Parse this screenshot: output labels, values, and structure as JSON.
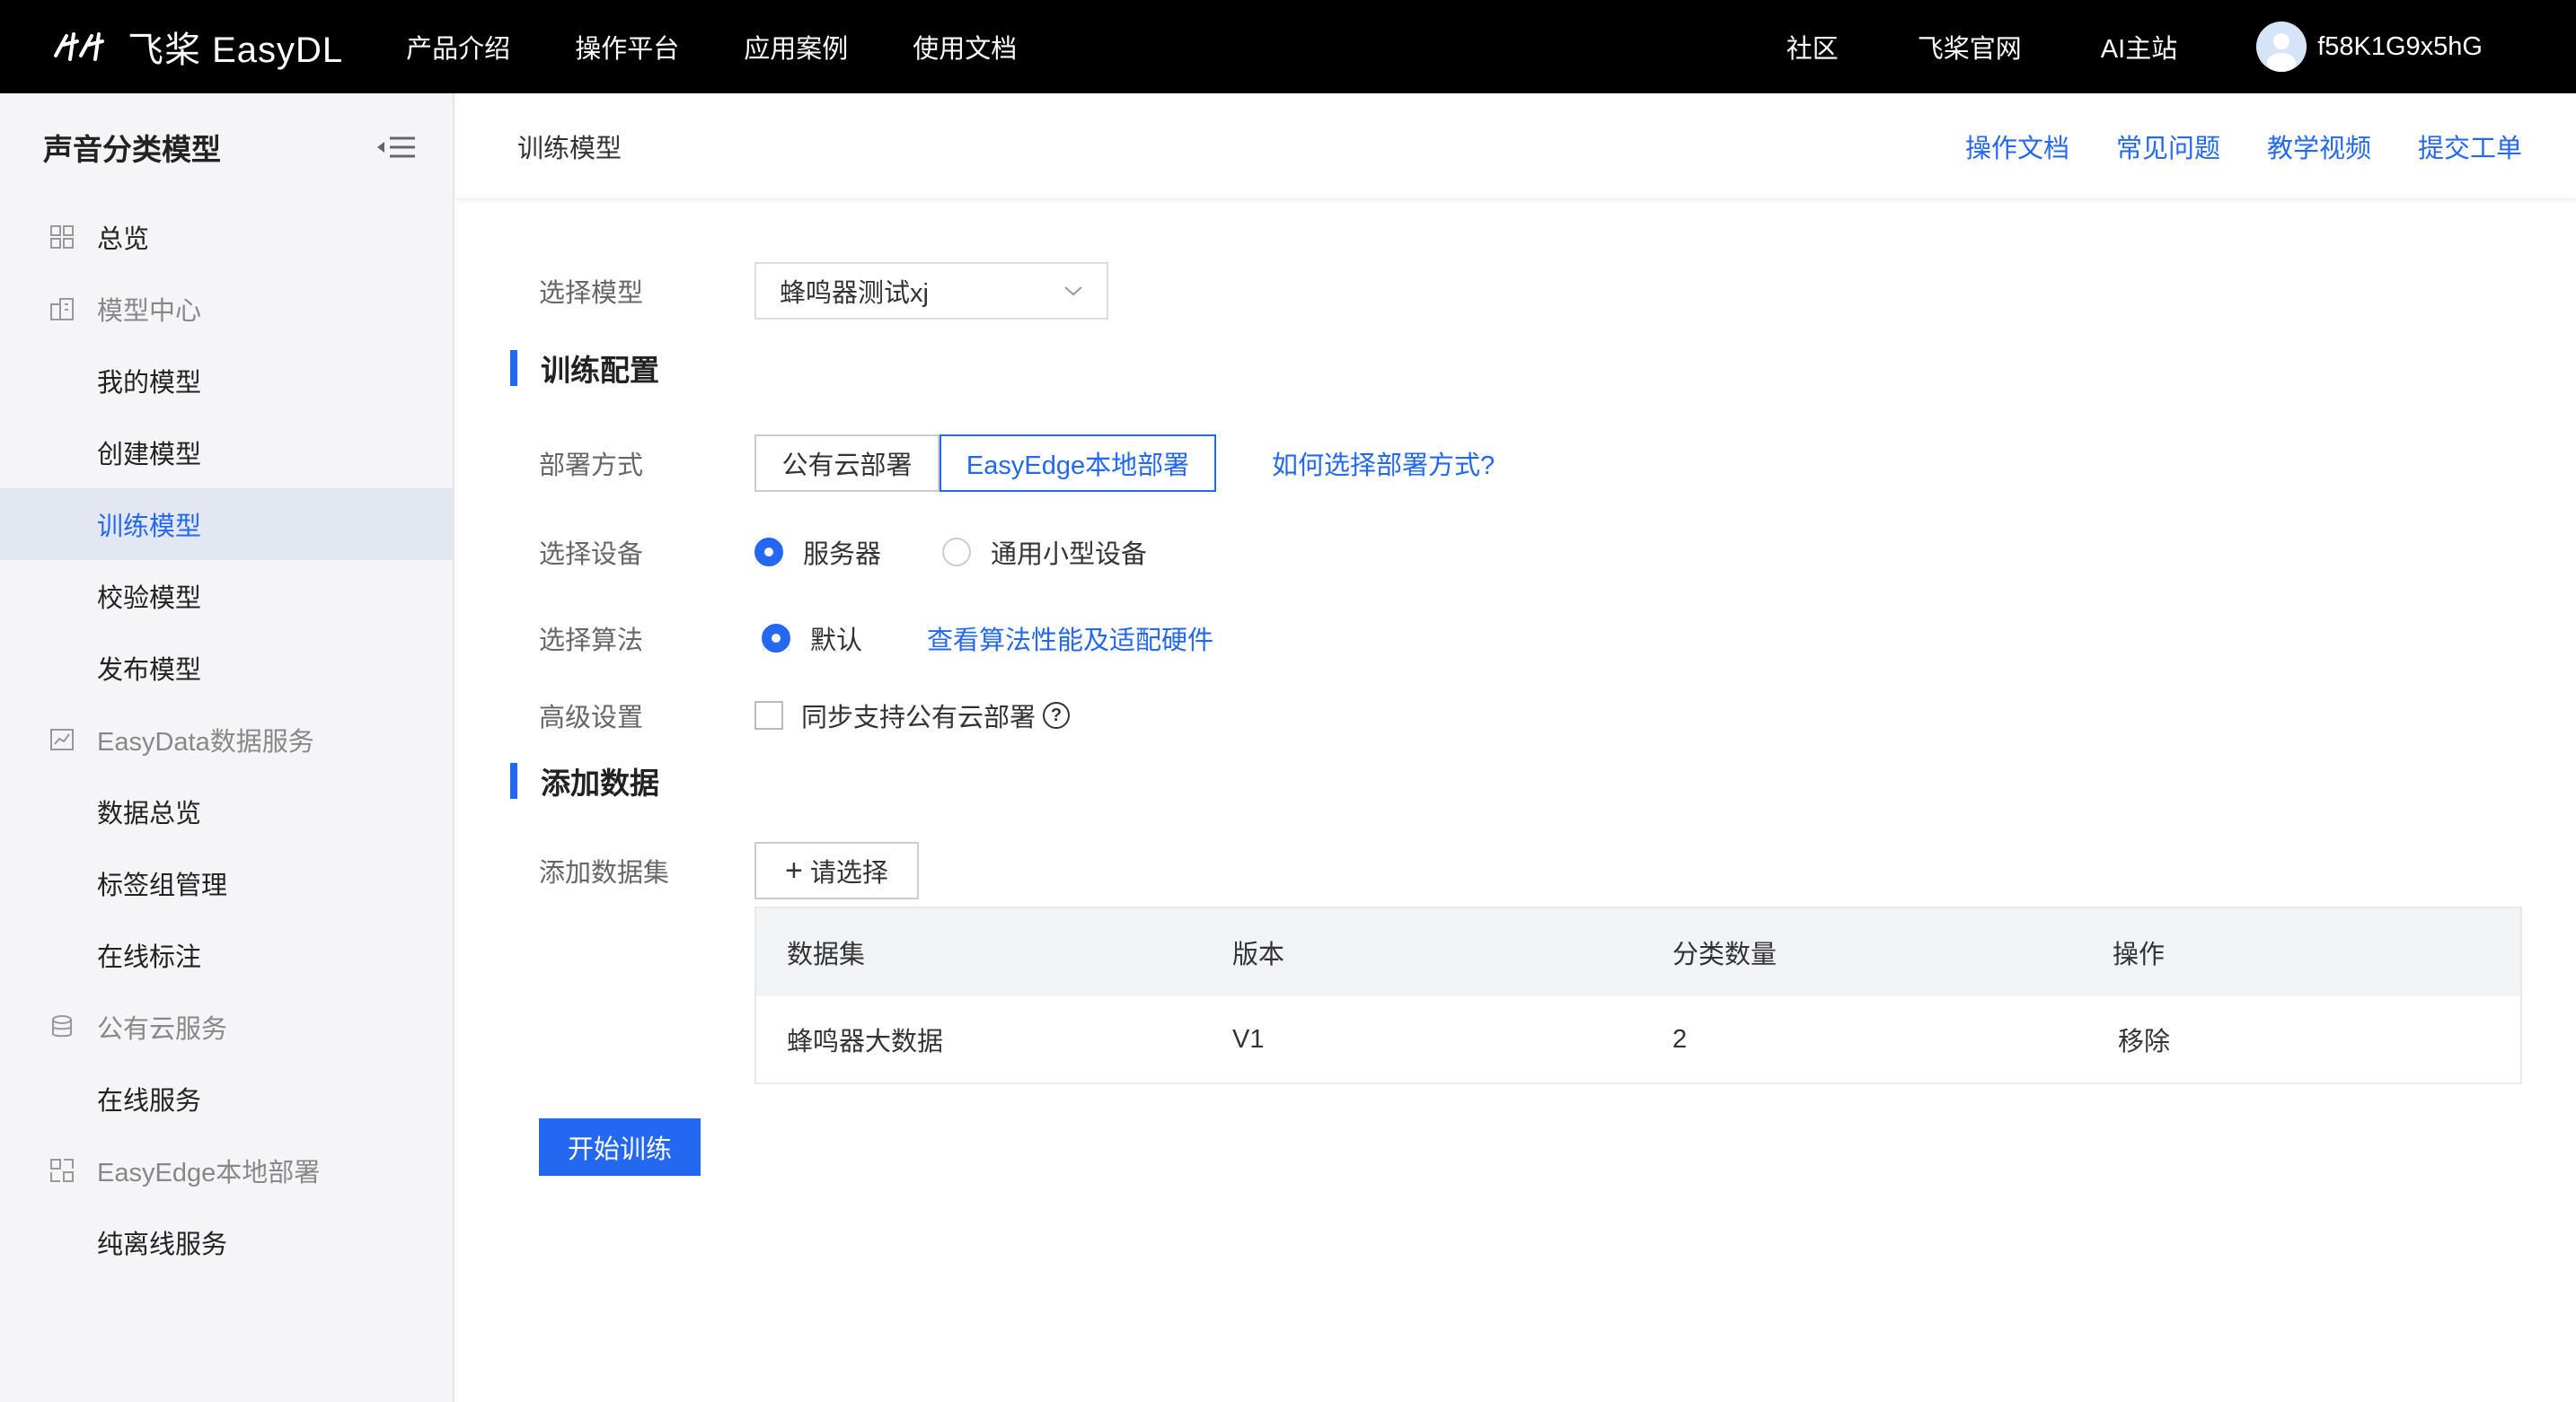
{
  "header": {
    "logo_text": "飞桨 EasyDL",
    "nav": [
      "产品介绍",
      "操作平台",
      "应用案例",
      "使用文档"
    ],
    "right_nav": [
      "社区",
      "飞桨官网",
      "AI主站"
    ],
    "username": "f58K1G9x5hG"
  },
  "sidebar": {
    "title": "声音分类模型",
    "items": [
      {
        "label": "总览",
        "type": "group",
        "icon": "grid-icon"
      },
      {
        "label": "模型中心",
        "type": "group",
        "icon": "building-icon"
      },
      {
        "label": "我的模型",
        "type": "sub"
      },
      {
        "label": "创建模型",
        "type": "sub"
      },
      {
        "label": "训练模型",
        "type": "sub",
        "active": true
      },
      {
        "label": "校验模型",
        "type": "sub"
      },
      {
        "label": "发布模型",
        "type": "sub"
      },
      {
        "label": "EasyData数据服务",
        "type": "group",
        "icon": "chart-icon"
      },
      {
        "label": "数据总览",
        "type": "sub"
      },
      {
        "label": "标签组管理",
        "type": "sub"
      },
      {
        "label": "在线标注",
        "type": "sub"
      },
      {
        "label": "公有云服务",
        "type": "group",
        "icon": "database-icon"
      },
      {
        "label": "在线服务",
        "type": "sub"
      },
      {
        "label": "EasyEdge本地部署",
        "type": "group",
        "icon": "edge-icon"
      },
      {
        "label": "纯离线服务",
        "type": "sub"
      }
    ]
  },
  "main": {
    "page_title": "训练模型",
    "help_links": [
      "操作文档",
      "常见问题",
      "教学视频",
      "提交工单"
    ],
    "select_model_label": "选择模型",
    "select_model_value": "蜂鸣器测试xj",
    "section_train": "训练配置",
    "deploy_label": "部署方式",
    "deploy_options": [
      "公有云部署",
      "EasyEdge本地部署"
    ],
    "deploy_help_link": "如何选择部署方式?",
    "device_label": "选择设备",
    "device_options": [
      "服务器",
      "通用小型设备"
    ],
    "algo_label": "选择算法",
    "algo_option": "默认",
    "algo_link": "查看算法性能及适配硬件",
    "advanced_label": "高级设置",
    "advanced_checkbox": "同步支持公有云部署",
    "section_data": "添加数据",
    "dataset_label": "添加数据集",
    "dataset_button": "请选择",
    "table_headers": [
      "数据集",
      "版本",
      "分类数量",
      "操作"
    ],
    "table_rows": [
      {
        "dataset": "蜂鸣器大数据",
        "version": "V1",
        "count": "2",
        "action": "移除"
      }
    ],
    "start_button": "开始训练"
  }
}
